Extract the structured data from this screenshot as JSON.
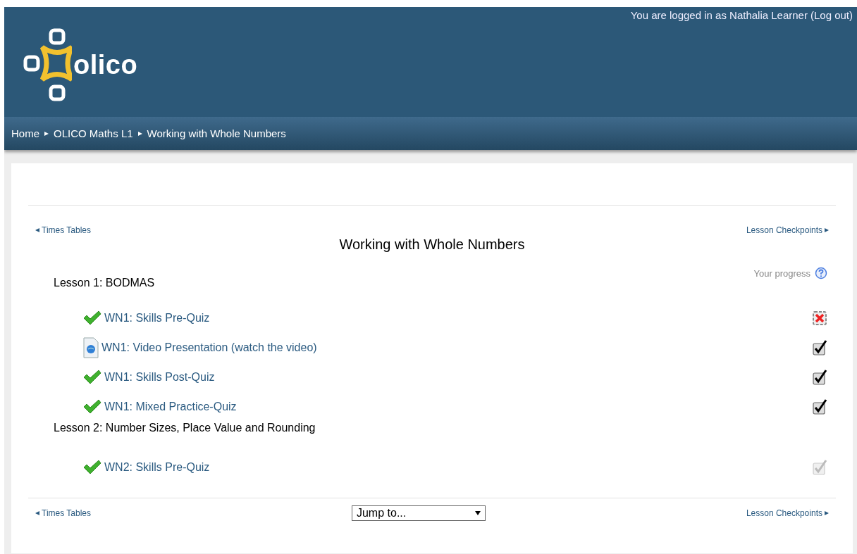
{
  "header": {
    "login_prefix": "You are logged in as Nathalia Learner",
    "logout": "(Log out)",
    "logo_text": "olico"
  },
  "breadcrumb": [
    "Home",
    "OLICO Maths L1",
    "Working with Whole Numbers"
  ],
  "nav_top": {
    "prev": "Times Tables",
    "next": "Lesson Checkpoints"
  },
  "title": "Working with Whole Numbers",
  "progress_label": "Your progress",
  "sections": [
    {
      "name": "Lesson 1: BODMAS",
      "activities": [
        {
          "kind": "quiz",
          "label": "WN1: Skills Pre-Quiz",
          "complete": false,
          "automatic": false
        },
        {
          "kind": "video",
          "label": "WN1: Video Presentation (watch the video)",
          "complete": true,
          "automatic": false
        },
        {
          "kind": "quiz",
          "label": "WN1: Skills Post-Quiz",
          "complete": true,
          "automatic": false
        },
        {
          "kind": "quiz",
          "label": "WN1: Mixed Practice-Quiz",
          "complete": true,
          "automatic": false
        }
      ]
    },
    {
      "name": "Lesson 2: Number Sizes, Place Value and Rounding",
      "activities": [
        {
          "kind": "quiz",
          "label": "WN2: Skills Pre-Quiz",
          "complete": true,
          "automatic": true
        }
      ]
    }
  ],
  "nav_bottom": {
    "prev": "Times Tables",
    "next": "Lesson Checkpoints",
    "jump": "Jump to..."
  }
}
